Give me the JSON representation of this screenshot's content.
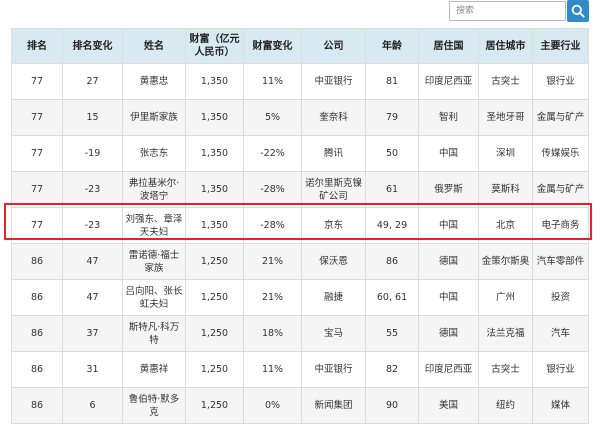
{
  "search": {
    "placeholder": "搜索",
    "icon": "search-icon"
  },
  "table": {
    "headers": [
      "排名",
      "排名变化",
      "姓名",
      "财富（亿元人民币）",
      "财富变化",
      "公司",
      "年龄",
      "居住国",
      "居住城市",
      "主要行业"
    ],
    "rows": [
      [
        "77",
        "27",
        "黄惠忠",
        "1,350",
        "11%",
        "中亚银行",
        "81",
        "印度尼西亚",
        "古突士",
        "银行业"
      ],
      [
        "77",
        "15",
        "伊里斯家族",
        "1,350",
        "5%",
        "奎奈科",
        "79",
        "智利",
        "圣地牙哥",
        "金属与矿产"
      ],
      [
        "77",
        "-19",
        "张志东",
        "1,350",
        "-22%",
        "腾讯",
        "50",
        "中国",
        "深圳",
        "传媒娱乐"
      ],
      [
        "77",
        "-23",
        "弗拉基米尔·波塔宁",
        "1,350",
        "-28%",
        "诺尔里斯克镍矿公司",
        "61",
        "俄罗斯",
        "莫斯科",
        "金属与矿产"
      ],
      [
        "77",
        "-23",
        "刘强东、章泽天夫妇",
        "1,350",
        "-28%",
        "京东",
        "49, 29",
        "中国",
        "北京",
        "电子商务"
      ],
      [
        "86",
        "47",
        "雷诺德·福士家族",
        "1,250",
        "21%",
        "保沃恩",
        "86",
        "德国",
        "金策尔斯奥",
        "汽车零部件"
      ],
      [
        "86",
        "47",
        "吕向阳、张长虹夫妇",
        "1,250",
        "21%",
        "融捷",
        "60, 61",
        "中国",
        "广州",
        "投资"
      ],
      [
        "86",
        "37",
        "斯特凡·科万特",
        "1,250",
        "18%",
        "宝马",
        "55",
        "德国",
        "法兰克福",
        "汽车"
      ],
      [
        "86",
        "31",
        "黄惠祥",
        "1,250",
        "11%",
        "中亚银行",
        "82",
        "印度尼西亚",
        "古突士",
        "银行业"
      ],
      [
        "86",
        "6",
        "鲁伯特·默多克",
        "1,250",
        "0%",
        "新闻集团",
        "90",
        "美国",
        "纽约",
        "媒体"
      ]
    ],
    "highlighted_row": 4
  },
  "colors": {
    "header_bg": "#d9e9f2",
    "search_button": "#2f8cc8",
    "highlight_border": "#e8222b"
  }
}
